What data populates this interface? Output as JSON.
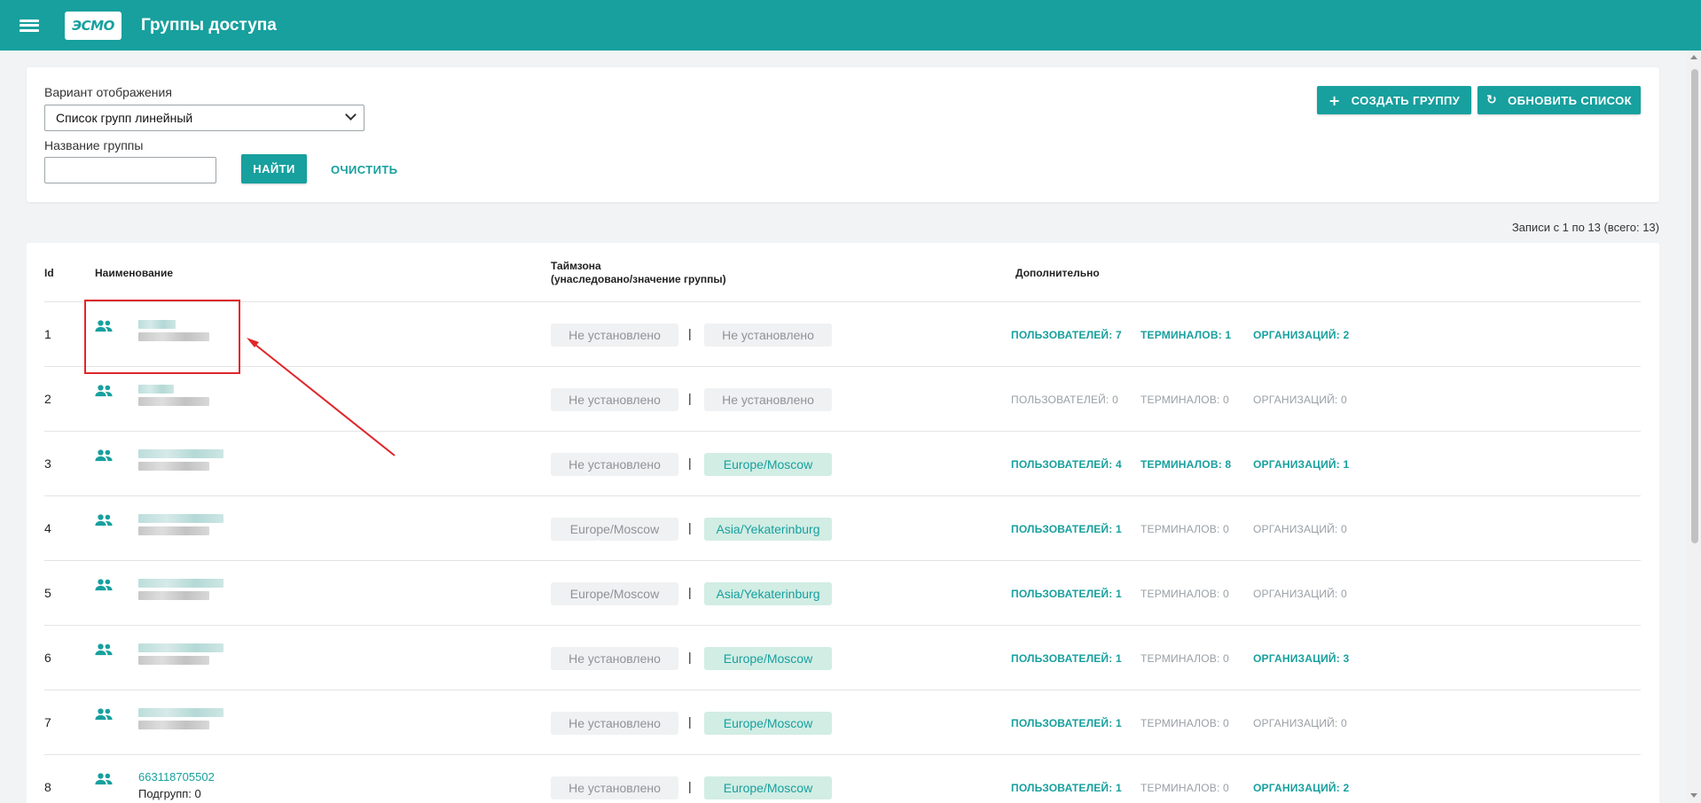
{
  "header": {
    "logo_text": "ЭСМО",
    "title": "Группы доступа"
  },
  "filters": {
    "view_label": "Вариант отображения",
    "view_value": "Список групп линейный",
    "name_label": "Название группы",
    "name_value": "",
    "find_button": "НАЙТИ",
    "clear_button": "ОЧИСТИТЬ",
    "create_button": "СОЗДАТЬ ГРУППУ",
    "refresh_button": "ОБНОВИТЬ СПИСОК"
  },
  "records_info": "Записи с 1 по 13 (всего: 13)",
  "table": {
    "columns": {
      "id": "Id",
      "name": "Наименование",
      "timezone_line1": "Таймзона",
      "timezone_line2": "(унаследовано/значение группы)",
      "extra": "Дополнительно"
    },
    "rows": [
      {
        "id": "1",
        "inherited_tz": "Не установлено",
        "group_tz": "Не установлено",
        "group_tz_set": false,
        "users": "ПОЛЬЗОВАТЕЛЕЙ: 7",
        "users_on": true,
        "terminals": "ТЕРМИНАЛОВ: 1",
        "terminals_on": true,
        "orgs": "ОРГАНИЗАЦИЙ: 2",
        "orgs_on": true
      },
      {
        "id": "2",
        "inherited_tz": "Не установлено",
        "group_tz": "Не установлено",
        "group_tz_set": false,
        "users": "ПОЛЬЗОВАТЕЛЕЙ: 0",
        "users_on": false,
        "terminals": "ТЕРМИНАЛОВ: 0",
        "terminals_on": false,
        "orgs": "ОРГАНИЗАЦИЙ: 0",
        "orgs_on": false
      },
      {
        "id": "3",
        "inherited_tz": "Не установлено",
        "group_tz": "Europe/Moscow",
        "group_tz_set": true,
        "users": "ПОЛЬЗОВАТЕЛЕЙ: 4",
        "users_on": true,
        "terminals": "ТЕРМИНАЛОВ: 8",
        "terminals_on": true,
        "orgs": "ОРГАНИЗАЦИЙ: 1",
        "orgs_on": true
      },
      {
        "id": "4",
        "inherited_tz": "Europe/Moscow",
        "group_tz": "Asia/Yekaterinburg",
        "group_tz_set": true,
        "users": "ПОЛЬЗОВАТЕЛЕЙ: 1",
        "users_on": true,
        "terminals": "ТЕРМИНАЛОВ: 0",
        "terminals_on": false,
        "orgs": "ОРГАНИЗАЦИЙ: 0",
        "orgs_on": false
      },
      {
        "id": "5",
        "inherited_tz": "Europe/Moscow",
        "group_tz": "Asia/Yekaterinburg",
        "group_tz_set": true,
        "users": "ПОЛЬЗОВАТЕЛЕЙ: 1",
        "users_on": true,
        "terminals": "ТЕРМИНАЛОВ: 0",
        "terminals_on": false,
        "orgs": "ОРГАНИЗАЦИЙ: 0",
        "orgs_on": false
      },
      {
        "id": "6",
        "inherited_tz": "Не установлено",
        "group_tz": "Europe/Moscow",
        "group_tz_set": true,
        "users": "ПОЛЬЗОВАТЕЛЕЙ: 1",
        "users_on": true,
        "terminals": "ТЕРМИНАЛОВ: 0",
        "terminals_on": false,
        "orgs": "ОРГАНИЗАЦИЙ: 3",
        "orgs_on": true
      },
      {
        "id": "7",
        "inherited_tz": "Не установлено",
        "group_tz": "Europe/Moscow",
        "group_tz_set": true,
        "users": "ПОЛЬЗОВАТЕЛЕЙ: 1",
        "users_on": true,
        "terminals": "ТЕРМИНАЛОВ: 0",
        "terminals_on": false,
        "orgs": "ОРГАНИЗАЦИЙ: 0",
        "orgs_on": false
      },
      {
        "id": "8",
        "name": "663118705502",
        "subgroups": "Подгрупп: 0",
        "inherited_tz": "Не установлено",
        "group_tz": "Europe/Moscow",
        "group_tz_set": true,
        "users": "ПОЛЬЗОВАТЕЛЕЙ: 1",
        "users_on": true,
        "terminals": "ТЕРМИНАЛОВ: 0",
        "terminals_on": false,
        "orgs": "ОРГАНИЗАЦИЙ: 2",
        "orgs_on": true
      }
    ]
  },
  "colors": {
    "brand": "#17a09e",
    "highlight": "#e0262a"
  }
}
